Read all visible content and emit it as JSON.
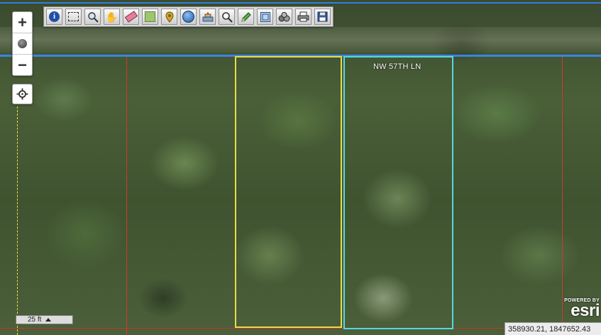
{
  "map": {
    "road_label": "NW 57TH LN"
  },
  "toolbar": {
    "tools": [
      {
        "icon": "info-icon"
      },
      {
        "icon": "select-icon"
      },
      {
        "icon": "zoom-area-icon"
      },
      {
        "icon": "pan-hand-icon"
      },
      {
        "icon": "eraser-icon"
      },
      {
        "icon": "full-extent-icon"
      },
      {
        "icon": "pin-icon"
      },
      {
        "icon": "globe-icon"
      },
      {
        "icon": "buffer-icon"
      },
      {
        "icon": "magnifier-icon"
      },
      {
        "icon": "pencil-icon"
      },
      {
        "icon": "grid-icon"
      },
      {
        "icon": "layers-icon"
      },
      {
        "icon": "print-icon"
      },
      {
        "icon": "save-icon"
      }
    ]
  },
  "zoom": {
    "in": "+",
    "out": "−"
  },
  "scalebar": {
    "label": "25 ft"
  },
  "attribution": {
    "powered_by": "POWERED BY",
    "brand": "esri"
  },
  "coords": {
    "text": "358930.21, 1847652.43"
  },
  "colors": {
    "parcel_selected": "#e8dc4a",
    "parcel_highlight": "#57d8dc",
    "road_line": "#3a84e6",
    "parcel_boundary": "#d23a2a"
  }
}
